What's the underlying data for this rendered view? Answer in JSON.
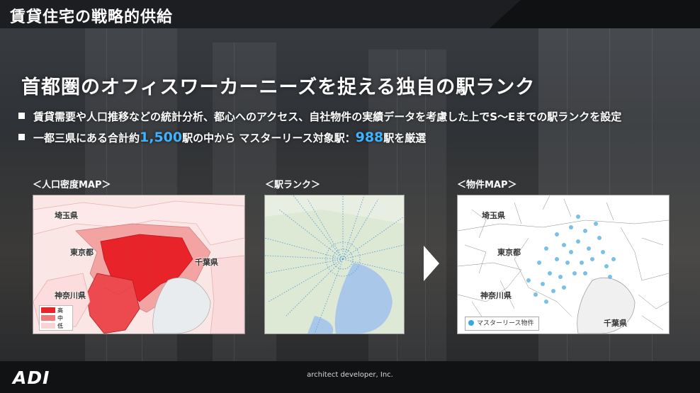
{
  "header": {
    "title": "賃貸住宅の戦略的供給"
  },
  "headline": "首都圏のオフィスワーカーニーズを捉える独自の駅ランク",
  "bullets": {
    "b1": "賃貸需要や人口推移などの統計分析、都心へのアクセス、自社物件の実績データを考慮した上でS～Eまでの駅ランクを設定",
    "b2_pre": "一都三県にある合計約",
    "b2_num1": "1,500",
    "b2_mid": "駅の中から マスターリース対象駅：",
    "b2_num2": "988",
    "b2_post": "駅を厳選"
  },
  "maps": {
    "population": {
      "label": "＜人口密度MAP＞",
      "prefectures": {
        "saitama": "埼玉県",
        "tokyo": "東京都",
        "chiba": "千葉県",
        "kanagawa": "神奈川県"
      },
      "legend": {
        "high": "高",
        "mid": "中",
        "low": "低"
      }
    },
    "station": {
      "label": "＜駅ランク＞"
    },
    "property": {
      "label": "＜物件MAP＞",
      "prefectures": {
        "saitama": "埼玉県",
        "tokyo": "東京都",
        "kanagawa": "神奈川県",
        "chiba": "千葉県"
      },
      "legend": "マスターリース物件"
    }
  },
  "colors": {
    "accent": "#3fb3ff",
    "high": "#e8242a",
    "mid": "#f07a7a",
    "low": "#f9d3d3",
    "pin": "#3aa8e0"
  },
  "footer": {
    "logo": "ADI",
    "company": "architect developer, Inc."
  }
}
